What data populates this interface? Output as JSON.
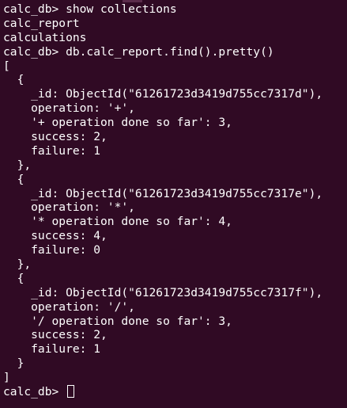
{
  "terminal": {
    "lines": [
      "calc_db> show collections",
      "calc_report",
      "calculations",
      "calc_db> db.calc_report.find().pretty()",
      "[",
      "  {",
      "    _id: ObjectId(\"61261723d3419d755cc7317d\"),",
      "    operation: '+',",
      "    '+ operation done so far': 3,",
      "    success: 2,",
      "    failure: 1",
      "  },",
      "  {",
      "    _id: ObjectId(\"61261723d3419d755cc7317e\"),",
      "    operation: '*',",
      "    '* operation done so far': 4,",
      "    success: 4,",
      "    failure: 0",
      "  },",
      "  {",
      "    _id: ObjectId(\"61261723d3419d755cc7317f\"),",
      "    operation: '/',",
      "    '/ operation done so far': 3,",
      "    success: 2,",
      "    failure: 1",
      "  }",
      "]"
    ],
    "prompt": "calc_db> ",
    "colors": {
      "background": "#300a24",
      "foreground": "#ffffff"
    }
  }
}
